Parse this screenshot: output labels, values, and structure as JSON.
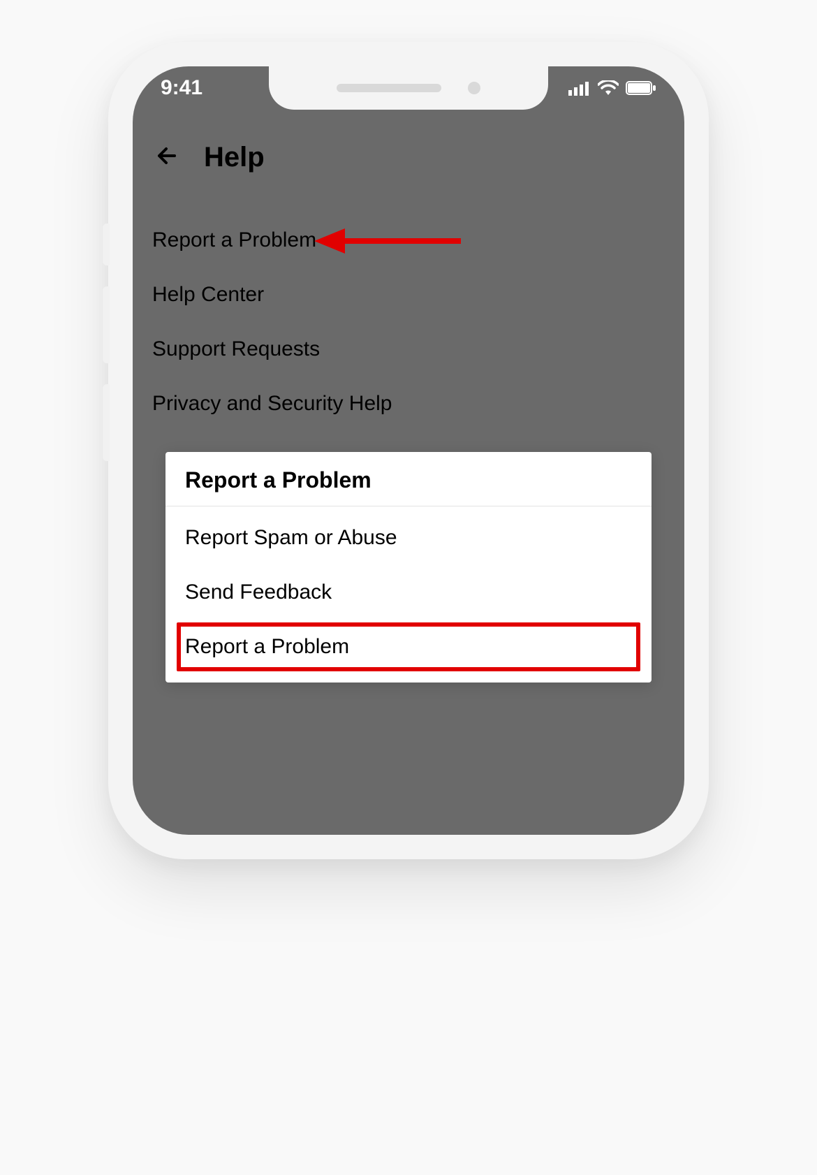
{
  "status": {
    "time": "9:41"
  },
  "header": {
    "title": "Help"
  },
  "menu": {
    "items": [
      {
        "label": "Report a Problem"
      },
      {
        "label": "Help Center"
      },
      {
        "label": "Support Requests"
      },
      {
        "label": "Privacy and Security Help"
      }
    ]
  },
  "dialog": {
    "title": "Report a Problem",
    "items": [
      {
        "label": "Report Spam or Abuse"
      },
      {
        "label": "Send Feedback"
      },
      {
        "label": "Report a Problem",
        "highlighted": true
      }
    ]
  },
  "annotation": {
    "arrow_color": "#e10000",
    "highlight_box_color": "#e10000"
  }
}
